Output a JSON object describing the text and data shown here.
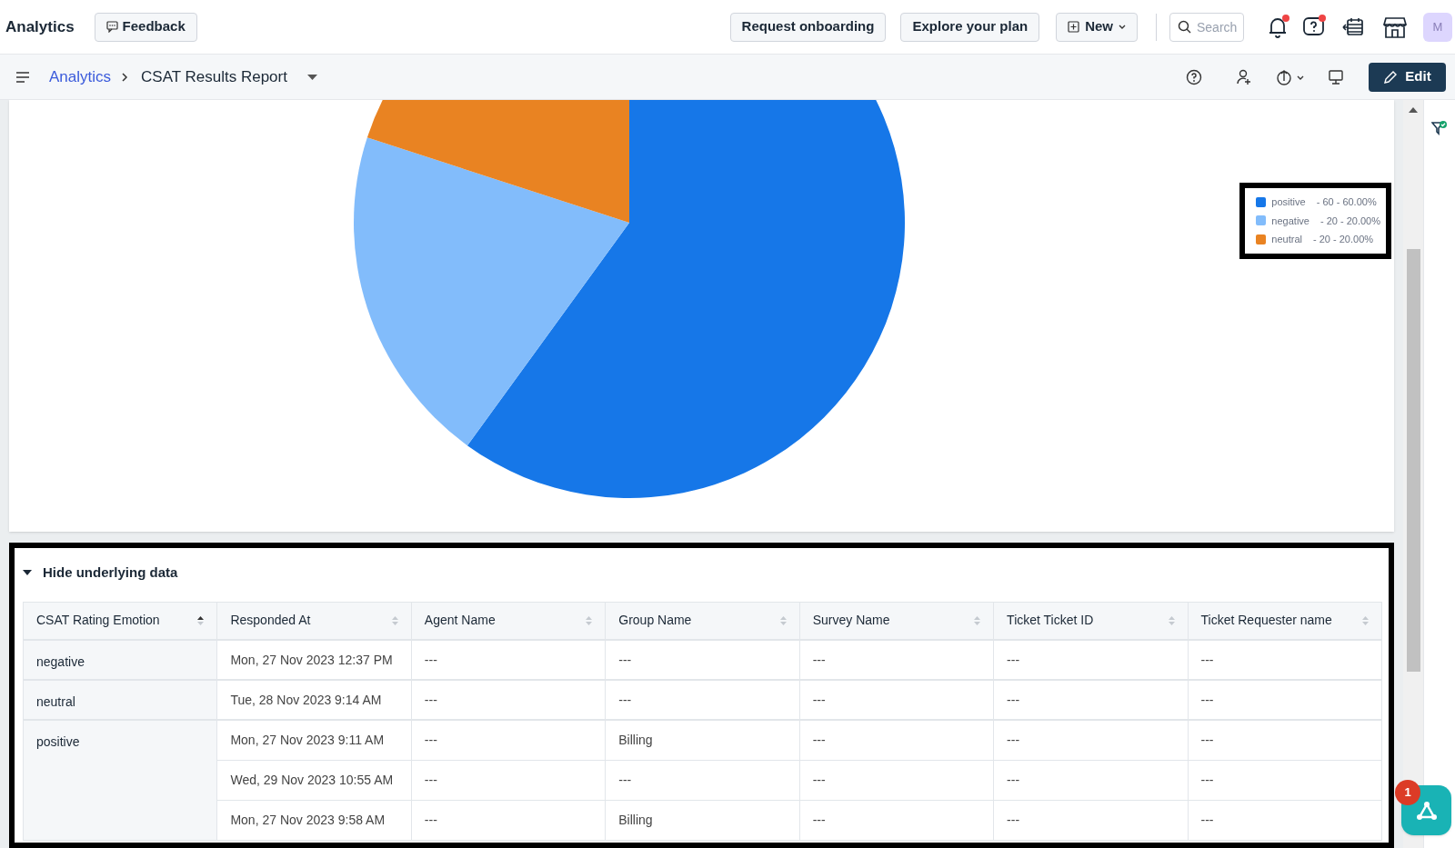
{
  "topbar": {
    "title": "Analytics",
    "feedback": "Feedback",
    "buttons": [
      "Request onboarding",
      "Explore your plan"
    ],
    "new_button": "New",
    "search": {
      "placeholder": "Search"
    },
    "notifications": {
      "unread": true
    },
    "help": {
      "unread": true
    },
    "avatar": "M"
  },
  "breadcrumb": {
    "parent": "Analytics",
    "current": "CSAT Results Report"
  },
  "toolbar": {
    "edit": "Edit"
  },
  "chart": {
    "chart_data": {
      "type": "pie",
      "categories": [
        "positive",
        "negative",
        "neutral"
      ],
      "values": [
        60,
        20,
        20
      ],
      "legend": true
    },
    "legend": [
      {
        "reading": "- 60 - 60.00%",
        "color": "#1677e8"
      },
      {
        "reading": "- 20 - 20.00%",
        "color": "#82bcfb"
      },
      {
        "reading": "- 20 - 20.00%",
        "color": "#e98322"
      }
    ]
  },
  "underlying": {
    "toggle": "Hide underlying data",
    "expanded": true,
    "columns": [
      {
        "label": "CSAT Rating Emotion",
        "sorted": true
      },
      {
        "label": "Responded At",
        "sorted": false
      },
      {
        "label": "Agent Name",
        "sorted": false
      },
      {
        "label": "Group Name",
        "sorted": false
      },
      {
        "label": "Survey Name",
        "sorted": false
      },
      {
        "label": "Ticket Ticket ID",
        "sorted": false
      },
      {
        "label": "Ticket Requester name",
        "sorted": false
      }
    ],
    "groups": [
      {
        "emotion": "negative",
        "rows": [
          [
            "Mon, 27 Nov 2023 12:37 PM",
            "---",
            "---",
            "---",
            "---",
            "---"
          ]
        ]
      },
      {
        "emotion": "neutral",
        "rows": [
          [
            "Tue, 28 Nov 2023 9:14 AM",
            "---",
            "---",
            "---",
            "---",
            "---"
          ]
        ]
      },
      {
        "emotion": "positive",
        "rows": [
          [
            "Mon, 27 Nov 2023 9:11 AM",
            "---",
            "Billing",
            "---",
            "---",
            "---"
          ],
          [
            "Wed, 29 Nov 2023 10:55 AM",
            "---",
            "---",
            "---",
            "---",
            "---"
          ],
          [
            "Mon, 27 Nov 2023 9:58 AM",
            "---",
            "Billing",
            "---",
            "---",
            "---"
          ]
        ]
      }
    ]
  },
  "assistant": {
    "badge": "1"
  }
}
